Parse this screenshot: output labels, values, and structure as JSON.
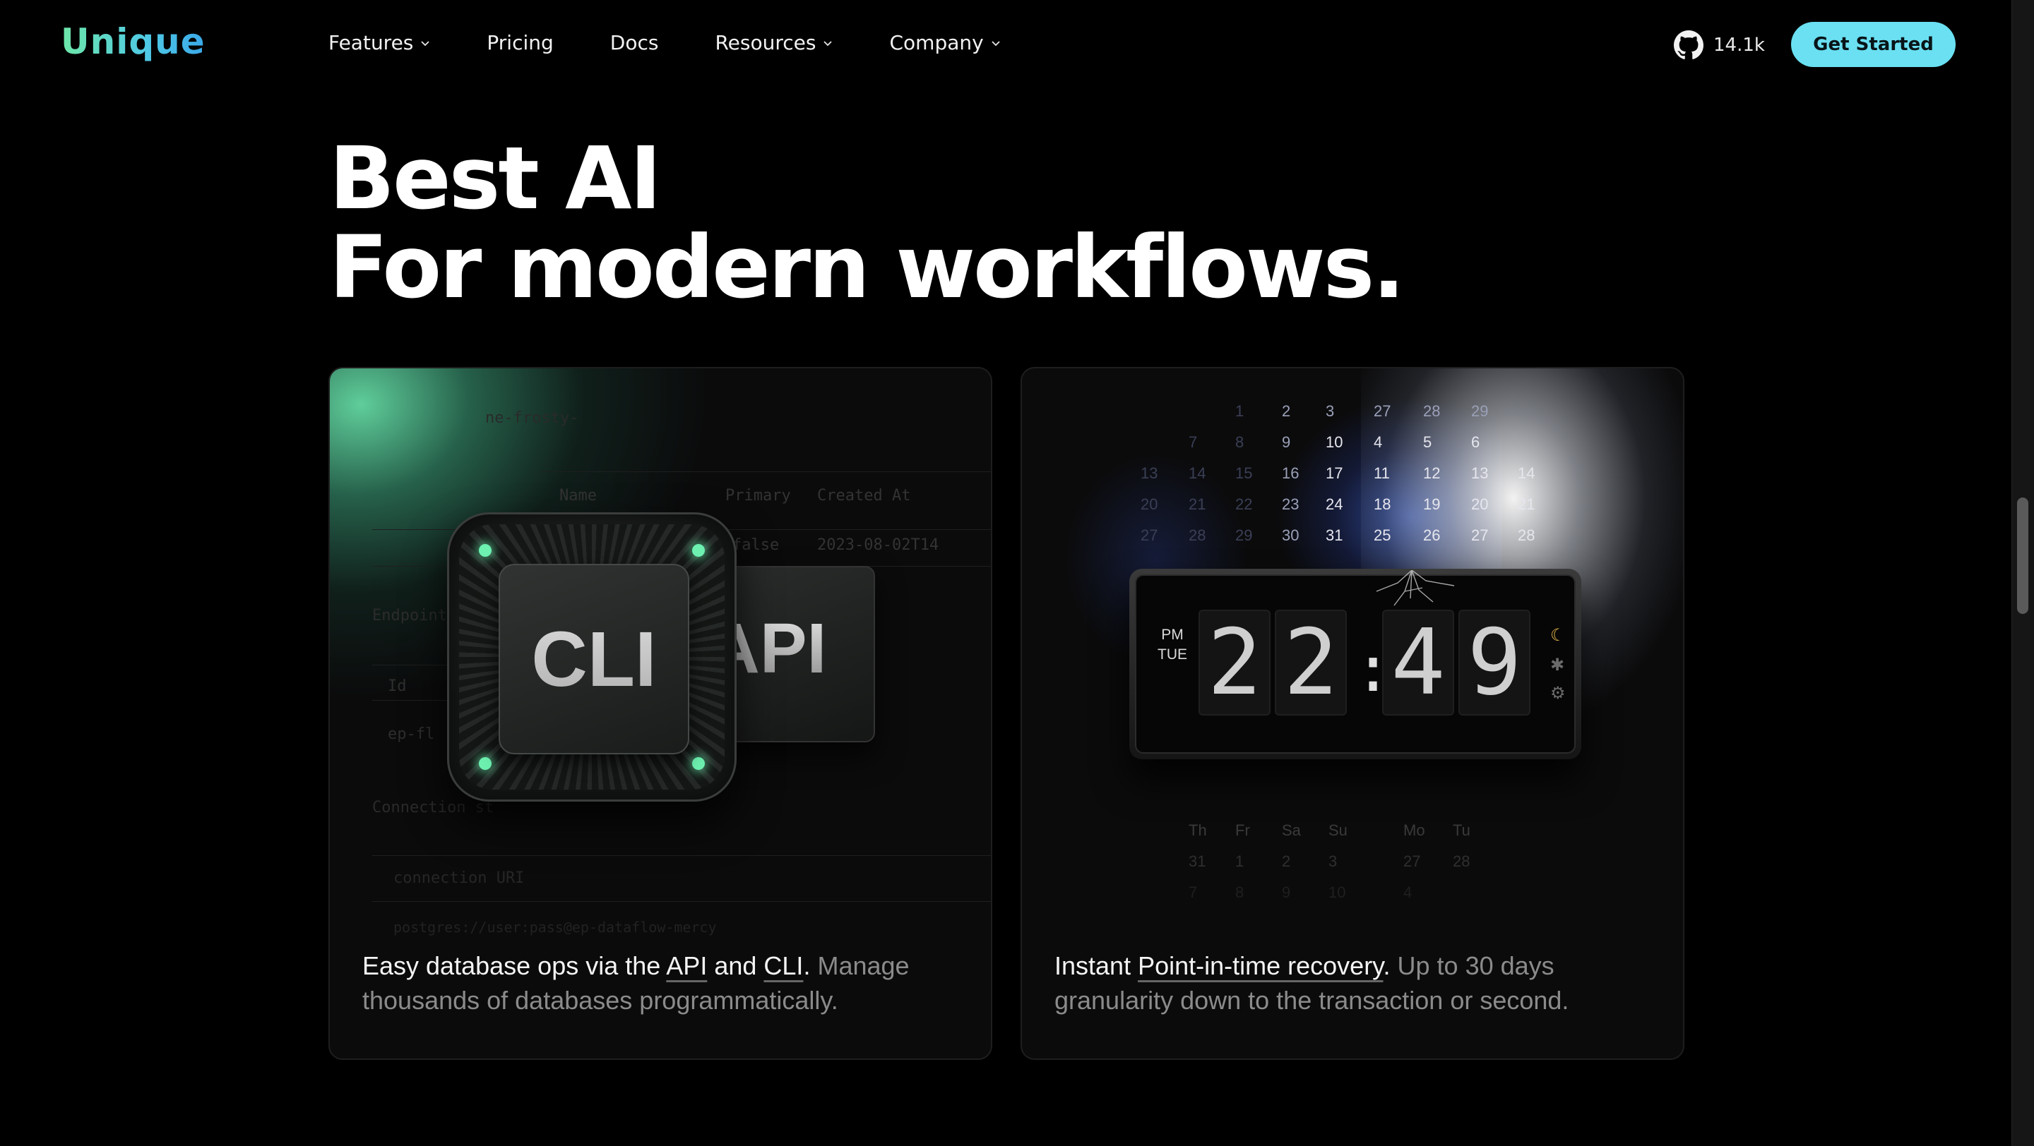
{
  "nav": {
    "logo": "Unique",
    "menu": [
      {
        "label": "Features",
        "has_dropdown": true
      },
      {
        "label": "Pricing",
        "has_dropdown": false
      },
      {
        "label": "Docs",
        "has_dropdown": false
      },
      {
        "label": "Resources",
        "has_dropdown": true
      },
      {
        "label": "Company",
        "has_dropdown": true
      }
    ],
    "github": {
      "icon": "github-icon",
      "stars": "14.1k"
    },
    "cta_label": "Get Started"
  },
  "hero": {
    "line1": "Best AI",
    "line2": "For modern workflows."
  },
  "cards": [
    {
      "art": {
        "chip_label": "CLI",
        "api_label": "API",
        "ghost_text": [
          "ne-frosty-",
          "Name",
          "Primary",
          "Created At",
          "false",
          "2023-08-02T14",
          "Endpoint",
          "Id",
          "ep-fl",
          "Connection st",
          "connection URI",
          "postgres://user:pass@ep-dataflow-mercy"
        ]
      },
      "text": {
        "lead": "Easy database ops via the ",
        "link1": "API",
        "mid": " and ",
        "link2": "CLI",
        "period": ".",
        "rest": " Manage thousands of databases programmatically."
      }
    },
    {
      "art": {
        "clock": {
          "ampm": "PM",
          "day": "TUE",
          "hour1": "2",
          "hour2": "2",
          "min1": "4",
          "min2": "9"
        },
        "calendar_top": [
          [
            "1",
            "2",
            "3",
            "27",
            "28",
            "29"
          ],
          [
            "7",
            "8",
            "9",
            "10",
            "4",
            "5",
            "6"
          ],
          [
            "13",
            "14",
            "15",
            "16",
            "17",
            "11",
            "12",
            "13",
            "14"
          ],
          [
            "20",
            "21",
            "22",
            "23",
            "24",
            "18",
            "19",
            "20",
            "21"
          ],
          [
            "27",
            "28",
            "29",
            "30",
            "31",
            "25",
            "26",
            "27",
            "28"
          ]
        ],
        "calendar_bottom_headers": [
          "Th",
          "Fr",
          "Sa",
          "Su",
          "Mo",
          "Tu"
        ],
        "calendar_bottom_rows": [
          [
            "31",
            "1",
            "2",
            "3",
            "27",
            "28"
          ],
          [
            "7",
            "8",
            "9",
            "10",
            "4"
          ]
        ]
      },
      "text": {
        "lead": "Instant ",
        "link1": "Point-in-time recovery",
        "period": ".",
        "rest": " Up to 30 days granularity down to the transaction or second."
      }
    }
  ],
  "colors": {
    "accent": "#6ae0f2",
    "logo_from": "#6ee7a8",
    "logo_to": "#3aa8e8",
    "led": "#6df0b0",
    "moon": "#e8b84a"
  }
}
